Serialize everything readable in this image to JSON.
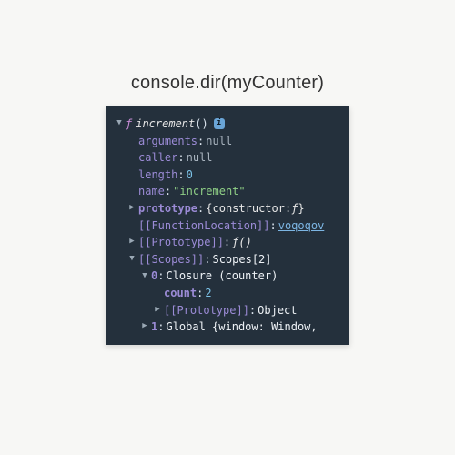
{
  "title": "console.dir(myCounter)",
  "fn": {
    "glyph": "ƒ",
    "name": "increment",
    "parens": "()",
    "info": "i"
  },
  "props": {
    "arguments": {
      "key": "arguments",
      "value": "null"
    },
    "caller": {
      "key": "caller",
      "value": "null"
    },
    "length": {
      "key": "length",
      "value": "0"
    },
    "name": {
      "key": "name",
      "value": "\"increment\""
    }
  },
  "prototype": {
    "key": "prototype",
    "value_prefix": "{constructor: ",
    "value_fn": "ƒ",
    "value_suffix": "}"
  },
  "functionLocation": {
    "key": "[[FunctionLocation]]",
    "value": "voqoqov"
  },
  "proto1": {
    "key": "[[Prototype]]",
    "value_fn": "ƒ",
    "value_parens": " ()"
  },
  "scopes": {
    "key": "[[Scopes]]",
    "value": "Scopes[2]"
  },
  "scope0": {
    "key": "0",
    "value": "Closure (counter)"
  },
  "count": {
    "key": "count",
    "value": "2"
  },
  "proto2": {
    "key": "[[Prototype]]",
    "value": "Object"
  },
  "scope1": {
    "key": "1",
    "value": "Global {window: Window,"
  }
}
